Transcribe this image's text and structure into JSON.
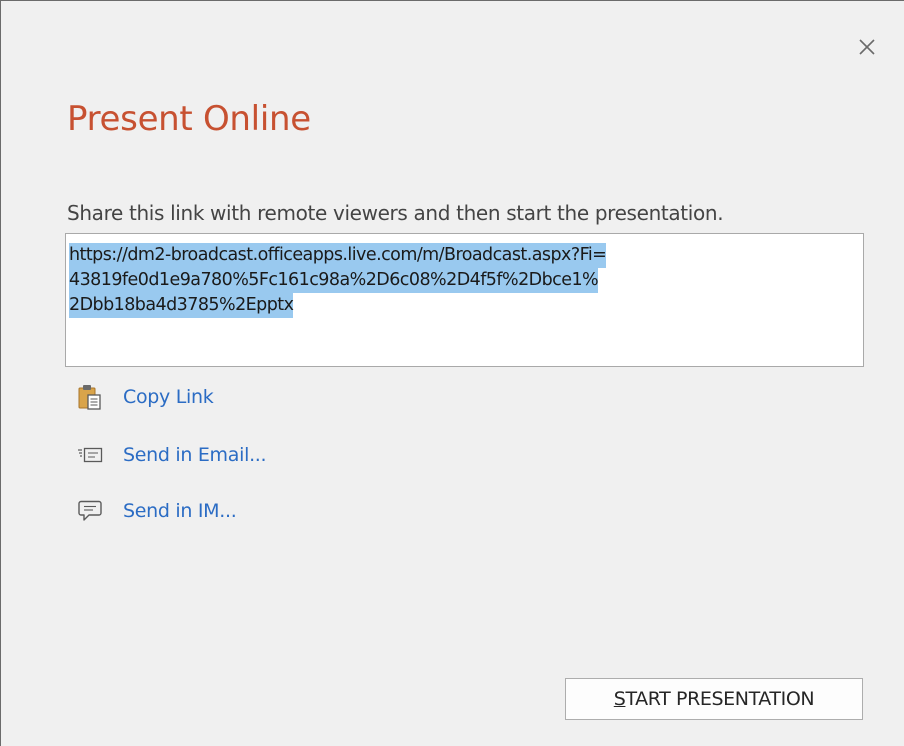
{
  "dialog": {
    "title": "Present Online",
    "instructions": "Share this link with remote viewers and then start the presentation.",
    "link_lines": [
      "https://dm2-broadcast.officeapps.live.com/m/Broadcast.aspx?Fi=",
      "43819fe0d1e9a780%5Fc161c98a%2D6c08%2D4f5f%2Dbce1%",
      "2Dbb18ba4d3785%2Epptx"
    ],
    "actions": [
      {
        "label": "Copy Link",
        "icon": "clipboard-icon"
      },
      {
        "label": "Send in Email...",
        "icon": "email-icon"
      },
      {
        "label": "Send in IM...",
        "icon": "chat-bubble-icon"
      }
    ],
    "start_button": {
      "mnemonic": "S",
      "rest": "TART PRESENTATION"
    },
    "close_icon": "close-icon"
  },
  "colors": {
    "title": "#c75131",
    "link": "#2b6cc4",
    "selection": "#99c9ef",
    "background": "#f0f0f0"
  }
}
